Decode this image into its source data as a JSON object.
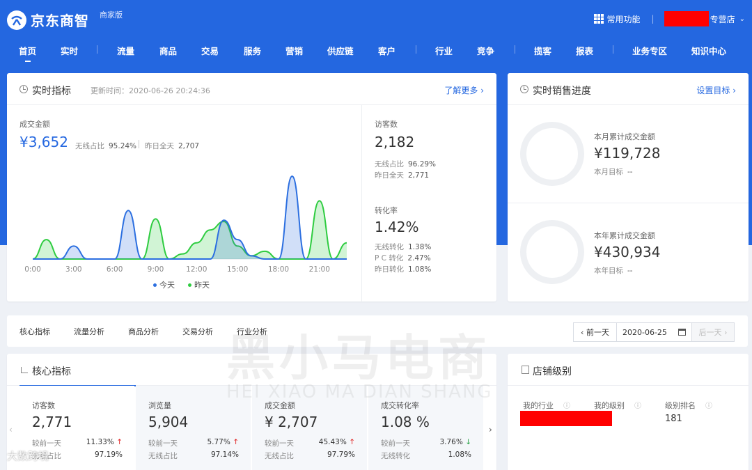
{
  "header": {
    "brand": "京东商智",
    "edition": "商家版",
    "common_functions": "常用功能",
    "separator": "|",
    "shop_suffix": "专营店"
  },
  "nav": {
    "items": [
      "首页",
      "实时",
      "流量",
      "商品",
      "交易",
      "服务",
      "营销",
      "供应链",
      "客户",
      "行业",
      "竞争",
      "揽客",
      "报表",
      "业务专区",
      "知识中心"
    ],
    "active": "首页"
  },
  "realtime": {
    "title": "实时指标",
    "update_time": "更新时间：2020-06-26 20:24:36",
    "more": "了解更多 ›",
    "gmv_label": "成交金额",
    "gmv_value": "¥3,652",
    "wireless_ratio_label": "无线占比",
    "wireless_ratio": "95.24%",
    "yesterday_label": "昨日全天",
    "yesterday_value": "2,707",
    "visitors_label": "访客数",
    "visitors_value": "2,182",
    "visitors_wireless_label": "无线占比",
    "visitors_wireless": "96.29%",
    "visitors_yesterday_label": "昨日全天",
    "visitors_yesterday": "2,771",
    "conv_label": "转化率",
    "conv_value": "1.42%",
    "conv_wireless_label": "无线转化",
    "conv_wireless": "1.38%",
    "conv_pc_label": "P C 转化",
    "conv_pc": "2.47%",
    "conv_yesterday_label": "昨日转化",
    "conv_yesterday": "1.08%"
  },
  "chart_data": {
    "type": "area",
    "x_ticks": [
      "0:00",
      "3:00",
      "6:00",
      "9:00",
      "12:00",
      "15:00",
      "18:00",
      "21:00"
    ],
    "x": [
      0,
      1,
      2,
      3,
      4,
      5,
      6,
      7,
      8,
      9,
      10,
      11,
      12,
      13,
      14,
      15,
      16,
      17,
      18,
      19,
      20,
      21,
      22,
      23
    ],
    "series": [
      {
        "name": "今天",
        "color": "#2c6fe0",
        "values": [
          0,
          0,
          0,
          20,
          0,
          0,
          0,
          75,
          0,
          0,
          0,
          0,
          0,
          0,
          60,
          30,
          5,
          0,
          0,
          128,
          0,
          0,
          0,
          0
        ]
      },
      {
        "name": "昨天",
        "color": "#2ecc40",
        "values": [
          0,
          30,
          0,
          0,
          0,
          0,
          0,
          0,
          0,
          62,
          0,
          8,
          25,
          45,
          58,
          20,
          5,
          12,
          0,
          0,
          0,
          90,
          0,
          25
        ]
      }
    ],
    "ylim": [
      0,
      140
    ],
    "grid": false,
    "legend": "bottom-center"
  },
  "sales": {
    "title": "实时销售进度",
    "set_target": "设置目标 ›",
    "month_label": "本月累计成交金额",
    "month_value": "¥119,728",
    "month_target_label": "本月目标",
    "month_target": "--",
    "year_label": "本年累计成交金额",
    "year_value": "¥430,934",
    "year_target_label": "本年目标",
    "year_target": "--"
  },
  "tabs": {
    "items": [
      "核心指标",
      "流量分析",
      "商品分析",
      "交易分析",
      "行业分析"
    ],
    "prev_day": "‹ 前一天",
    "date": "2020-06-25",
    "next_day": "后一天 ›"
  },
  "core": {
    "title": "核心指标",
    "tiles": [
      {
        "label": "访客数",
        "value": "2,771",
        "r1_label": "较前一天",
        "r1_value": "11.33%",
        "r1_dir": "up",
        "r2_label": "无线占比",
        "r2_value": "97.19%"
      },
      {
        "label": "浏览量",
        "value": "5,904",
        "r1_label": "较前一天",
        "r1_value": "5.77%",
        "r1_dir": "up",
        "r2_label": "无线占比",
        "r2_value": "97.14%"
      },
      {
        "label": "成交金额",
        "value": "¥ 2,707",
        "r1_label": "较前一天",
        "r1_value": "45.43%",
        "r1_dir": "up",
        "r2_label": "无线占比",
        "r2_value": "97.79%"
      },
      {
        "label": "成交转化率",
        "value": "1.08 %",
        "r1_label": "较前一天",
        "r1_value": "3.76%",
        "r1_dir": "down",
        "r2_label": "无线转化",
        "r2_value": "1.08%"
      }
    ]
  },
  "shop_level": {
    "title": "店铺级别",
    "industry_label": "我的行业",
    "level_label": "我的级别",
    "rank_label": "级别排名",
    "rank_value": "181"
  },
  "watermark": {
    "cn": "黑小马电商",
    "en": "HEI XIAO MA DIAN SHANG",
    "bottom": "大数跨境"
  }
}
